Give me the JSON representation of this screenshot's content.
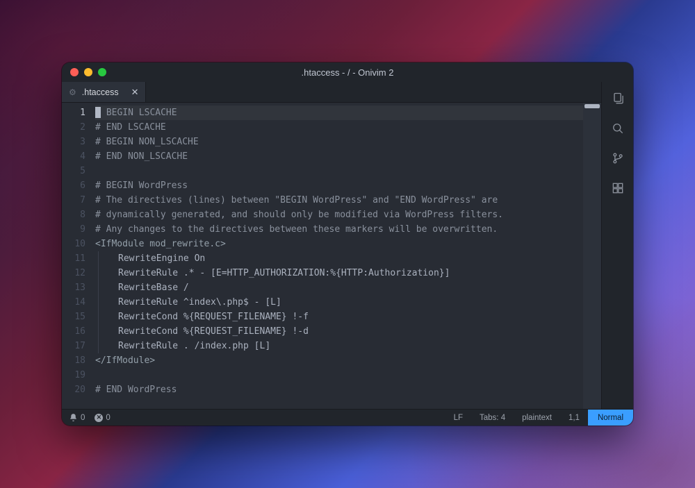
{
  "window": {
    "title": ".htaccess - / - Onivim 2"
  },
  "tab": {
    "label": ".htaccess"
  },
  "editor": {
    "active_line": 1,
    "lines": [
      "# BEGIN LSCACHE",
      "# END LSCACHE",
      "# BEGIN NON_LSCACHE",
      "# END NON_LSCACHE",
      "",
      "# BEGIN WordPress",
      "# The directives (lines) between \"BEGIN WordPress\" and \"END WordPress\" are",
      "# dynamically generated, and should only be modified via WordPress filters.",
      "# Any changes to the directives between these markers will be overwritten.",
      "<IfModule mod_rewrite.c>",
      "    RewriteEngine On",
      "    RewriteRule .* - [E=HTTP_AUTHORIZATION:%{HTTP:Authorization}]",
      "    RewriteBase /",
      "    RewriteRule ^index\\.php$ - [L]",
      "    RewriteCond %{REQUEST_FILENAME} !-f",
      "    RewriteCond %{REQUEST_FILENAME} !-d",
      "    RewriteRule . /index.php [L]",
      "</IfModule>",
      "",
      "# END WordPress"
    ]
  },
  "status": {
    "notifications": "0",
    "errors": "0",
    "line_ending": "LF",
    "tabs": "Tabs: 4",
    "language": "plaintext",
    "position": "1,1",
    "mode": "Normal"
  },
  "sidebar_icons": [
    "files",
    "search",
    "git",
    "extensions"
  ]
}
